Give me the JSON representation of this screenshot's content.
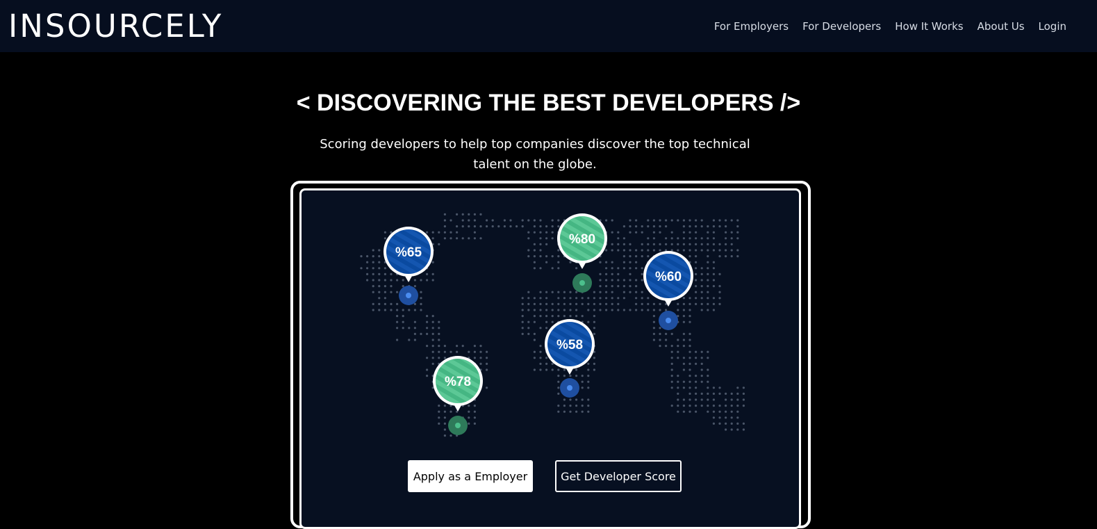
{
  "brand": {
    "logo": "INSOURCELY"
  },
  "nav": {
    "items": [
      {
        "label": "For Employers"
      },
      {
        "label": "For Developers"
      },
      {
        "label": "How It Works"
      },
      {
        "label": "About Us"
      },
      {
        "label": "Login"
      }
    ]
  },
  "hero": {
    "title": "< DISCOVERING THE BEST DEVELOPERS />",
    "subtitle_line1": "Scoring developers to help top companies discover the top technical",
    "subtitle_line2": "talent on the globe."
  },
  "map_pins": [
    {
      "label": "%65",
      "color": "blue"
    },
    {
      "label": "%80",
      "color": "green"
    },
    {
      "label": "%60",
      "color": "blue"
    },
    {
      "label": "%58",
      "color": "blue"
    },
    {
      "label": "%78",
      "color": "green"
    }
  ],
  "colors": {
    "navbar_bg": "#060e1f",
    "panel_bg": "#071021",
    "pin_blue": "#0a4aa0",
    "pin_green": "#4cc08c",
    "map_dot": "#4a5568"
  },
  "cta": {
    "employer_label": "Apply as a Employer",
    "developer_label": "Get Developer Score"
  }
}
